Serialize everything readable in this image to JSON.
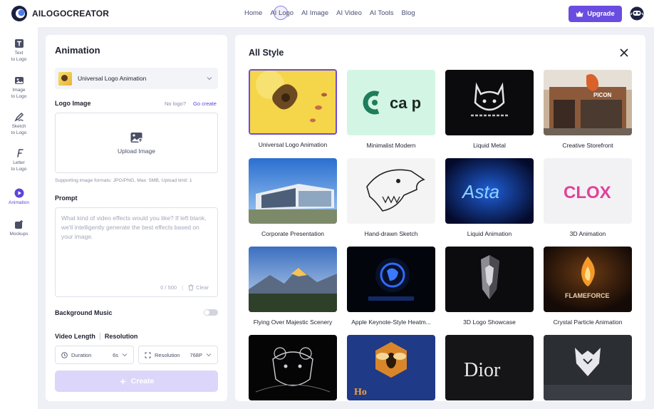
{
  "brand": {
    "name": "AILOGOCREATOR"
  },
  "nav": {
    "items": [
      "Home",
      "AI Logo",
      "AI Image",
      "AI Video",
      "AI Tools",
      "Blog"
    ],
    "upgrade_label": "Upgrade"
  },
  "rail": {
    "items": [
      {
        "label": "Text\nto Logo",
        "icon": "text-t-icon"
      },
      {
        "label": "Image\nto Logo",
        "icon": "image-icon"
      },
      {
        "label": "Sketch\nto Logo",
        "icon": "pen-icon"
      },
      {
        "label": "Letter\nto Logo",
        "icon": "letter-f-icon"
      },
      {
        "label": "Animation",
        "icon": "play-icon",
        "active": true
      },
      {
        "label": "Mockups",
        "icon": "mockup-icon"
      }
    ]
  },
  "panel": {
    "title": "Animation",
    "selected_style": "Universal Logo Animation",
    "logo_image_label": "Logo Image",
    "no_logo": "No logo?",
    "go_create": "Go create",
    "upload_label": "Upload Image",
    "formats": "Supporting image formats: JPG/PNG, Max: 5MB, Upload limit: 1",
    "prompt_label": "Prompt",
    "prompt_placeholder": "What kind of video effects would you like? If left blank, we'll intelligently generate the best effects based on your image.",
    "char_count": "0 / 500",
    "clear_label": "Clear",
    "bg_music_label": "Background Music",
    "video_length_label": "Video Length",
    "resolution_label": "Resolution",
    "duration": {
      "label": "Duration",
      "value": "6s"
    },
    "resolution": {
      "label": "Resolution",
      "value": "768P"
    },
    "create_label": "Create"
  },
  "gallery": {
    "title": "All Style",
    "styles": [
      "Universal Logo Animation",
      "Minimalist Modern",
      "Liquid Metal",
      "Creative Storefront",
      "Corporate Presentation",
      "Hand-drawn Sketch",
      "Liquid Animation",
      "3D Animation",
      "Flying Over Majestic Scenery",
      "Apple Keynote-Style Heatm...",
      "3D Logo Showcase",
      "Crystal Particle Animation"
    ],
    "thumb_text": {
      "minimalist": "ca p",
      "liquid_anim": "Asta",
      "anim3d": "CLOX",
      "storefront": "PICON",
      "crystal": "FLAMEFORCE",
      "dior": "Dior",
      "honey": "Ho"
    }
  },
  "colors": {
    "accent": "#6a4ce0",
    "create_disabled": "#dcd6fa",
    "active_rail": "#5b45d8"
  }
}
